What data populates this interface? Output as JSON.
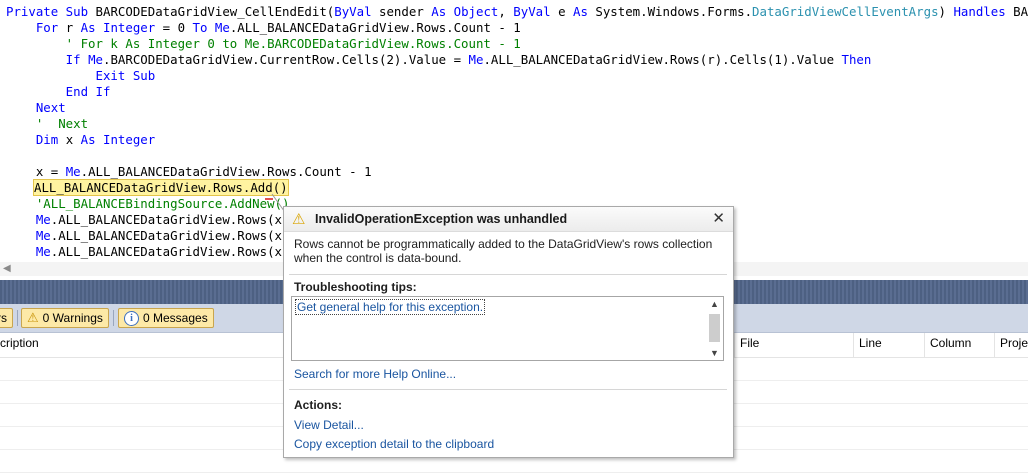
{
  "editor": {
    "lines": {
      "l1": {
        "a": "Private Sub ",
        "b": "BARCODEDataGridView_CellEndEdit(",
        "c": "ByVal ",
        "d": "sender ",
        "e": "As Object",
        "f": ", ",
        "g": "ByVal ",
        "h": "e ",
        "i": "As ",
        "j": "System.Windows.Forms.",
        "k": "DataGridViewCellEventArgs",
        "l": ") ",
        "m": "Handles ",
        "n": "BARCODEData"
      },
      "l2": {
        "a": "    For ",
        "b": "r ",
        "c": "As Integer ",
        "d": "= 0 ",
        "e": "To ",
        "f": "Me",
        "g": ".ALL_BALANCEDataGridView.Rows.Count - 1"
      },
      "l3": "        ' For k As Integer 0 to Me.BARCODEDataGridView.Rows.Count - 1",
      "l4": {
        "a": "        If ",
        "b": "Me",
        "c": ".BARCODEDataGridView.CurrentRow.Cells(2).Value = ",
        "d": "Me",
        "e": ".ALL_BALANCEDataGridView.Rows(r).Cells(1).Value ",
        "f": "Then"
      },
      "l5": "            Exit Sub",
      "l6": "        End If",
      "l7": "    Next",
      "l8": "    '  Next",
      "l9": {
        "a": "    Dim ",
        "b": "x ",
        "c": "As Integer"
      },
      "l10": {
        "a": "    x = ",
        "b": "Me",
        "c": ".ALL_BALANCEDataGridView.Rows.Count - 1"
      },
      "l11": "ALL_BALANCEDataGridView.Rows.Add()",
      "l12": "    'ALL_BALANCEBindingSource.AddNew()",
      "l13": {
        "a": "    ",
        "b": "Me",
        "c": ".ALL_BALANCEDataGridView.Rows(x).C"
      },
      "l14": {
        "a": "    ",
        "b": "Me",
        "c": ".ALL_BALANCEDataGridView.Rows(x).C"
      },
      "l15": {
        "a": "    ",
        "b": "Me",
        "c": ".ALL_BALANCEDataGridView.Rows(x).C"
      }
    }
  },
  "error_list": {
    "errors_partial": "rs",
    "warnings_label": "0 Warnings",
    "messages_label": "0 Messages",
    "columns": {
      "description": "cription",
      "file": "File",
      "line": "Line",
      "column": "Column",
      "project": "Proje"
    }
  },
  "exception_popup": {
    "title": "InvalidOperationException was unhandled",
    "message": "Rows cannot be programmatically added to the DataGridView's rows collection when the control is data-bound.",
    "tips_heading": "Troubleshooting tips:",
    "tip_link": "Get general help for this exception.",
    "search_link": "Search for more Help Online...",
    "actions_heading": "Actions:",
    "view_detail_link": "View Detail...",
    "copy_link": "Copy exception detail to the clipboard"
  },
  "colors": {
    "keyword": "#0000ff",
    "type": "#2b91af",
    "comment": "#008000",
    "link": "#1a55a0",
    "highlight": "#fff3a0"
  },
  "icons": [
    "warning-icon",
    "info-icon",
    "close-icon",
    "scroll-left-arrow-icon",
    "scroll-up-arrow-icon",
    "scroll-down-arrow-icon"
  ]
}
